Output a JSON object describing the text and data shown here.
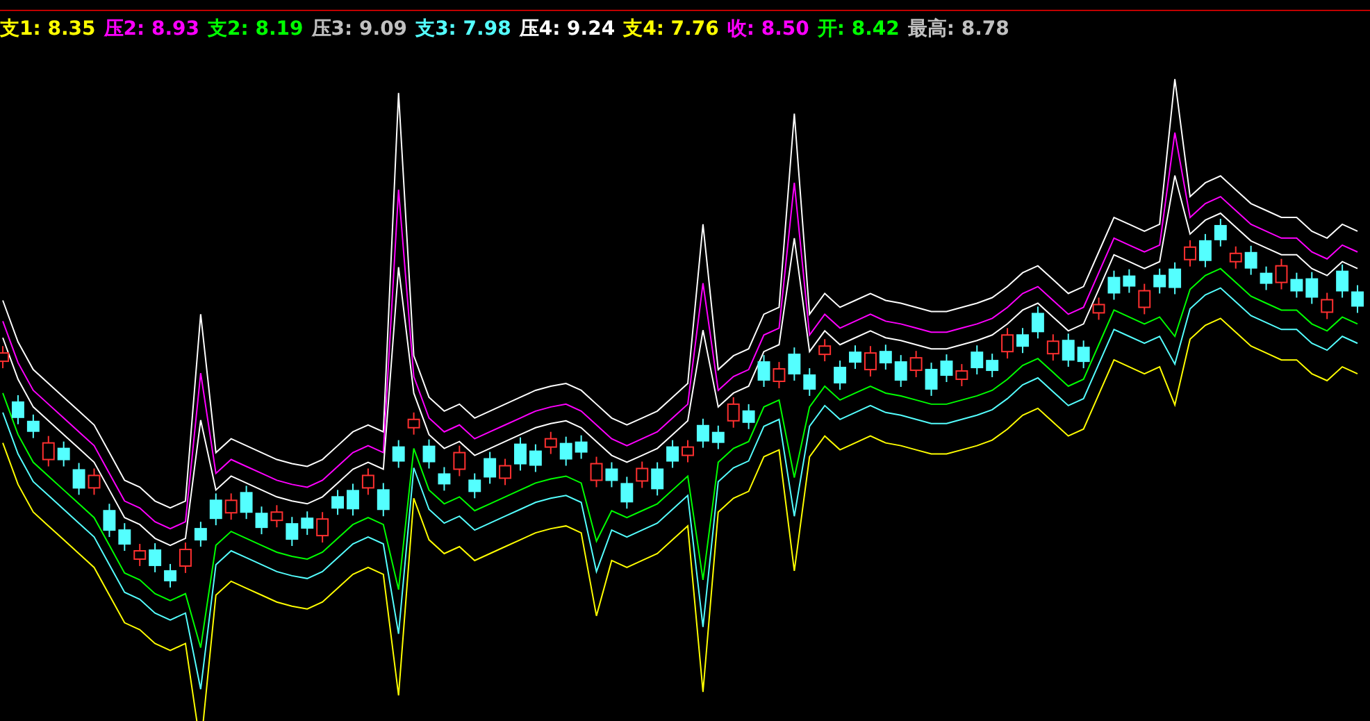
{
  "legend": [
    {
      "text": "支1: 8.35",
      "color": "#ffff00"
    },
    {
      "text": "压2: 8.93",
      "color": "#ff00ff"
    },
    {
      "text": "支2: 8.19",
      "color": "#00ff00"
    },
    {
      "text": "压3: 9.09",
      "color": "#c0c0c0"
    },
    {
      "text": "支3: 7.98",
      "color": "#54ffff"
    },
    {
      "text": "压4: 9.24",
      "color": "#ffffff"
    },
    {
      "text": "支4: 7.76",
      "color": "#ffff00"
    },
    {
      "text": "收: 8.50",
      "color": "#ff00ff"
    },
    {
      "text": "开: 8.42",
      "color": "#00ff00"
    },
    {
      "text": "最高: 8.78",
      "color": "#c0c0c0"
    }
  ]
}
